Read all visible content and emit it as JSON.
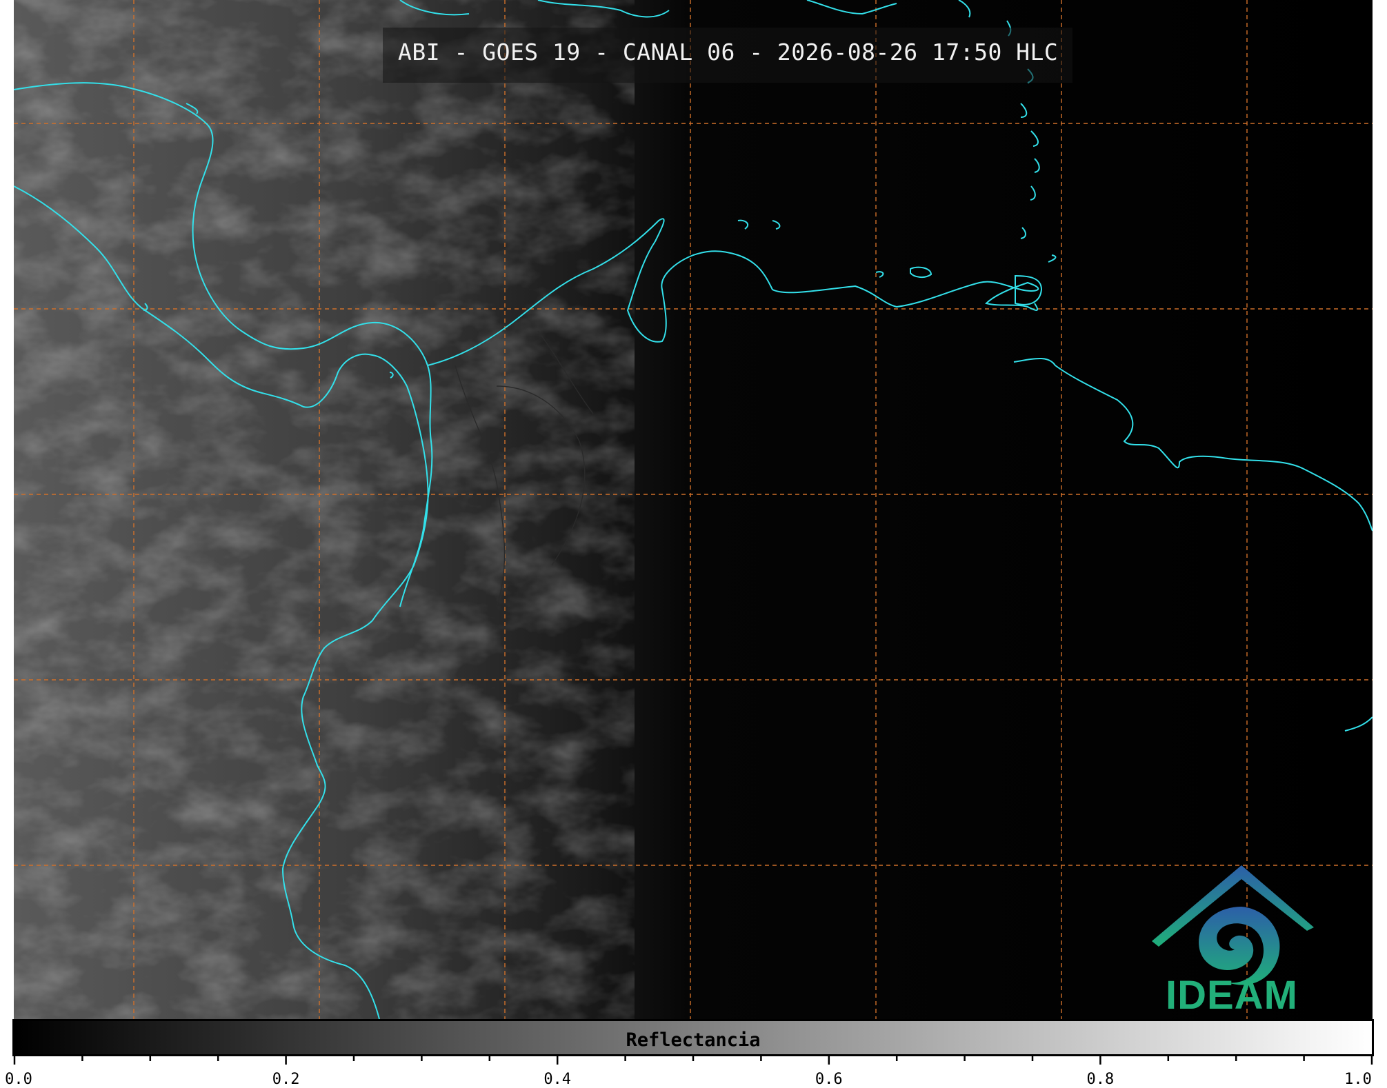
{
  "title": "ABI - GOES 19 - CANAL 06 - 2026-08-26 17:50 HLC",
  "colorbar": {
    "label": "Reflectancia",
    "min": 0.0,
    "max": 1.0,
    "tick_labels": [
      "0.0",
      "0.2",
      "0.4",
      "0.6",
      "0.8",
      "1.0"
    ]
  },
  "logo": {
    "text": "IDEAM"
  },
  "colors": {
    "coastline": "#33e0ea",
    "grid": "#d0702a",
    "background": "#000000"
  }
}
